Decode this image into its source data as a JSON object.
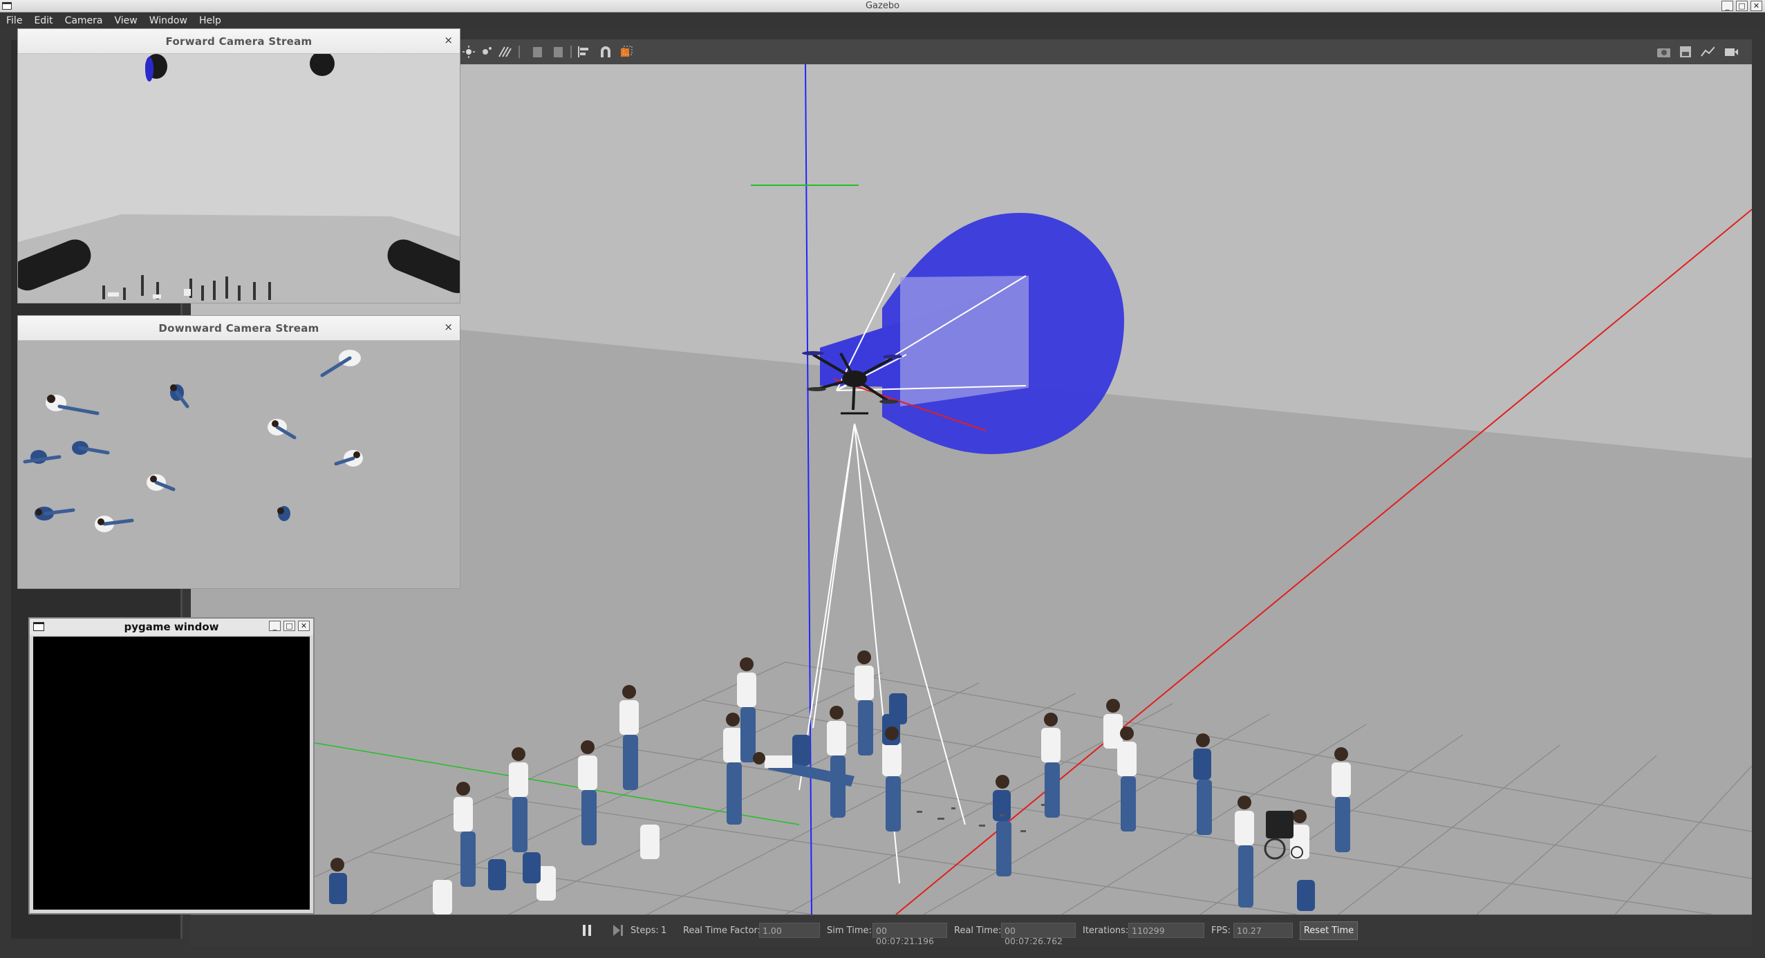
{
  "window": {
    "title": "Gazebo",
    "controls": [
      "_",
      "□",
      "✕"
    ]
  },
  "menu": [
    "File",
    "Edit",
    "Camera",
    "View",
    "Window",
    "Help"
  ],
  "toolbar": {
    "left_icons": [
      "translate-icon",
      "sun-icon",
      "point-light-icon",
      "spot-light-icon",
      "copy-icon",
      "paste-icon",
      "align-icon",
      "snap-icon",
      "change-view-icon"
    ],
    "right_icons": [
      "screenshot-icon",
      "log-icon",
      "plot-icon",
      "record-icon"
    ]
  },
  "forward_camera": {
    "title": "Forward Camera Stream",
    "close": "×"
  },
  "downward_camera": {
    "title": "Downward Camera Stream",
    "close": "×"
  },
  "pygame": {
    "title": "pygame window",
    "controls": [
      "_",
      "□",
      "✕"
    ]
  },
  "bottom": {
    "steps_label": "Steps:",
    "steps_value": "1",
    "rtf_label": "Real Time Factor:",
    "rtf_value": "1.00",
    "sim_time_label": "Sim Time:",
    "sim_time_value": "00 00:07:21.196",
    "real_time_label": "Real Time:",
    "real_time_value": "00 00:07:26.762",
    "iterations_label": "Iterations:",
    "iterations_value": "110299",
    "fps_label": "FPS:",
    "fps_value": "10.27",
    "reset_label": "Reset Time"
  },
  "colors": {
    "cone": "#3b3bdc",
    "z_axis": "#2323ff",
    "x_axis": "#e02020",
    "y_axis": "#22c022",
    "ground": "#a6a6a6",
    "sky": "#b9b9b9"
  }
}
